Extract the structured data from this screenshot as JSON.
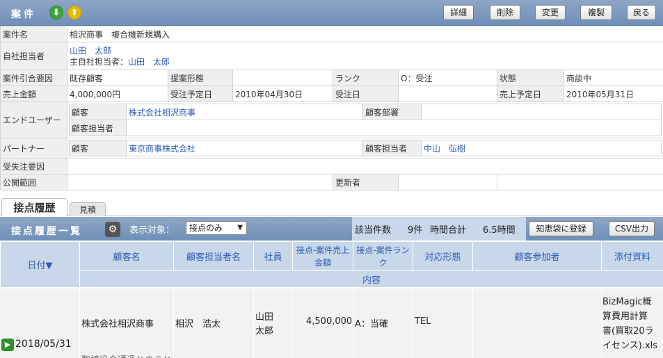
{
  "header": {
    "title": "案件",
    "buttons": {
      "detail": "詳細",
      "delete": "削除",
      "change": "変更",
      "duplicate": "複製",
      "back": "戻る"
    }
  },
  "info": {
    "case_name_label": "案件名",
    "case_name": "相沢商事　複合機新規購入",
    "staff_label": "自社担当者",
    "staff_line1": "山田　太郎",
    "staff_line2_prefix": "主自社担当者：",
    "staff_line2_name": "山田　太郎",
    "factor_label": "案件引合要因",
    "factor": "既存顧客",
    "proposal_label": "提案形態",
    "proposal": "",
    "rank_label": "ランク",
    "rank": "O：受注",
    "state_label": "状態",
    "state": "商談中",
    "sales_label": "売上金額",
    "sales": "4,000,000円",
    "order_plan_label": "受注予定日",
    "order_plan": "2010年04月30日",
    "order_date_label": "受注日",
    "order_date": "",
    "sales_plan_label": "売上予定日",
    "sales_plan": "2010年05月31日",
    "end_user_label": "エンドユーザー",
    "customer_label": "顧客",
    "end_customer": "株式会社相沢商事",
    "dept_label": "顧客部署",
    "end_dept": "",
    "cust_staff_label": "顧客担当者",
    "end_cust_staff": "",
    "partner_label": "パートナー",
    "partner_customer": "東京商事株式会社",
    "partner_staff_label": "顧客担当者",
    "partner_staff": "中山　弘樹",
    "loss_label": "受失注要因",
    "loss": "",
    "scope_label": "公開範囲",
    "scope": "",
    "updater_label": "更新者",
    "updater": ""
  },
  "tabs": {
    "history": "接点履歴",
    "estimate": "見積"
  },
  "history": {
    "title": "接点履歴一覧",
    "filter_label": "表示対象：",
    "filter_value": "接点のみ",
    "count_label": "該当件数",
    "count": "9件",
    "time_label": "時間合計",
    "time": "6.5時間",
    "kb_button": "知恵袋に登録",
    "csv_button": "CSV出力"
  },
  "grid": {
    "date": "日付▼",
    "customer": "顧客名",
    "customer_staff": "顧客担当者名",
    "employee": "社員",
    "amount": "接点-案件売上金額",
    "rank": "接点-案件ランク",
    "method": "対応形態",
    "participants": "顧客参加者",
    "attachment": "添付資料",
    "content": "内容"
  },
  "row": {
    "date": "2018/05/31",
    "customer": "株式会社相沢商事",
    "customer_staff": "相沢　浩太",
    "employee_line1": "山田",
    "employee_line2": "太郎",
    "amount": "4,500,000",
    "rank": "A：当確",
    "method": "TEL",
    "participants": "",
    "attachment_line1": "BizMagic概",
    "attachment_line2": "算費用計算",
    "attachment_line3": "書(買取20ラ",
    "attachment_line4": "イセンス).xls",
    "content_partial": "取締役会通過とのこと"
  }
}
